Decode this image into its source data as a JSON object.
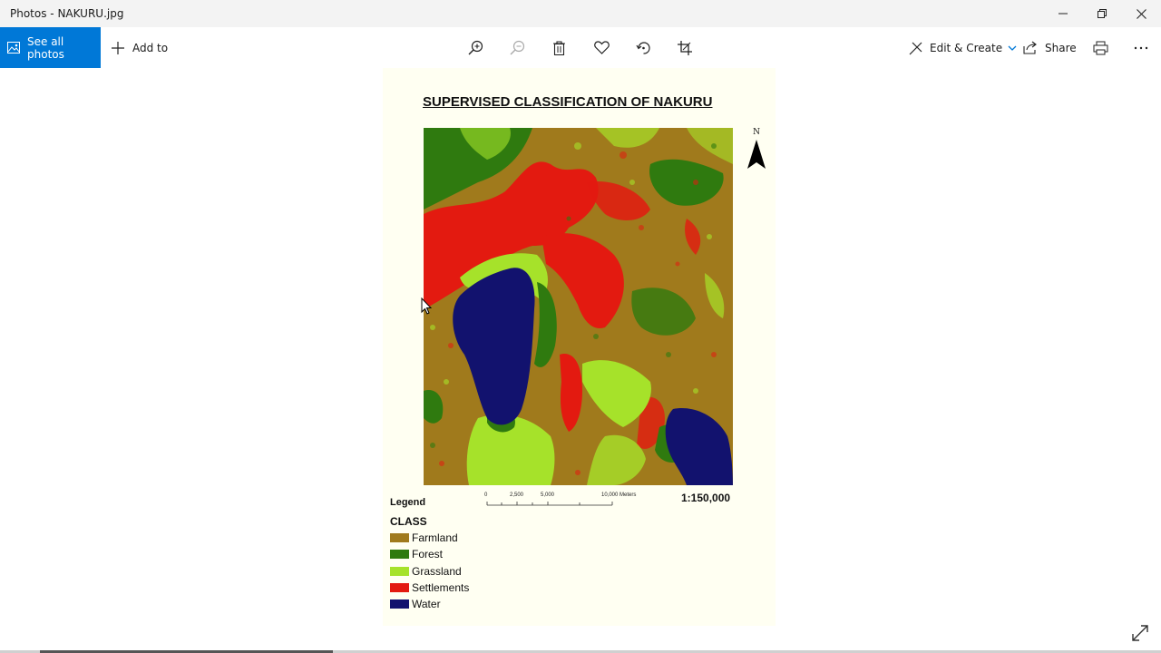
{
  "window": {
    "title": "Photos - NAKURU.jpg"
  },
  "toolbar": {
    "see_all_label": "See all photos",
    "add_to_label": "Add to",
    "edit_create_label": "Edit & Create",
    "share_label": "Share"
  },
  "map": {
    "title": "SUPERVISED CLASSIFICATION OF NAKURU",
    "north_label": "N",
    "scale_ticks": [
      "0",
      "2,500",
      "5,000",
      "10,000 Meters"
    ],
    "ratio": "1:150,000",
    "legend_title": "Legend",
    "legend_class": "CLASS",
    "legend": [
      {
        "label": "Farmland",
        "color": "#a07a1c"
      },
      {
        "label": "Forest",
        "color": "#2f7a0f"
      },
      {
        "label": "Grassland",
        "color": "#a6e22a"
      },
      {
        "label": "Settlements",
        "color": "#e31a10"
      },
      {
        "label": "Water",
        "color": "#12126e"
      }
    ]
  }
}
